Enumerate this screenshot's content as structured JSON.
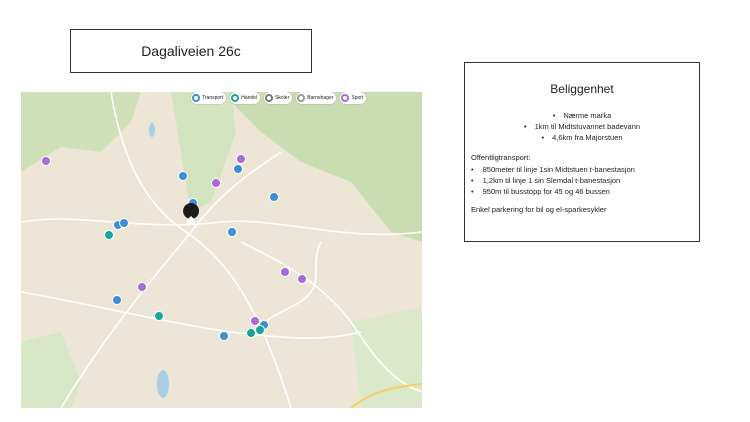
{
  "title": "Dagaliveien 26c",
  "map": {
    "legend": [
      {
        "label": "Transport",
        "color": "#3a8fd6",
        "icon": "bus-icon"
      },
      {
        "label": "Handel",
        "color": "#1aa39a",
        "icon": "cart-icon"
      },
      {
        "label": "Skoler",
        "color": "#777777",
        "icon": "school-icon"
      },
      {
        "label": "Barnehager",
        "color": "#999999",
        "icon": "kindergarten-icon"
      },
      {
        "label": "Sport",
        "color": "#a86ad6",
        "icon": "sport-icon"
      }
    ],
    "home_icon": "home-icon"
  },
  "info": {
    "title": "Beliggenhet",
    "highlights": [
      "Nærme marka",
      "1km til Midtstuvannet badevann",
      "4,6km fra Majorstuen"
    ],
    "transport_heading": "Offentligtransport:",
    "transport": [
      "850meter til linje 1sin Midtstuen t-banestasjon",
      "1,2km til linje 1 sin Slemdal t-banestasjon",
      "950m til busstopp for 45 og 46 bussen"
    ],
    "parking": "Enkel parkering for bil og el-sparkesykler"
  }
}
